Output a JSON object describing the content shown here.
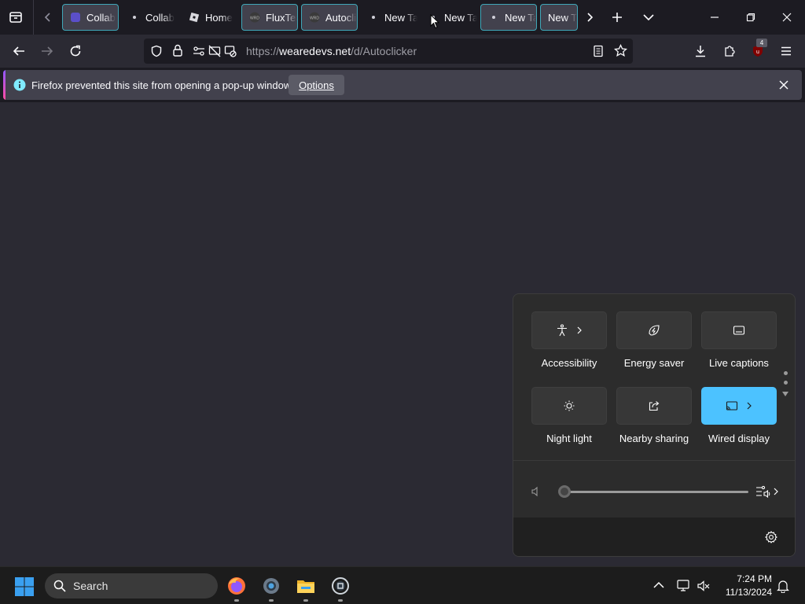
{
  "browser": {
    "tabs": [
      {
        "label": "Collab",
        "selected": true,
        "favicon": "collab-icon"
      },
      {
        "label": "Collab",
        "selected": false,
        "favicon": "dot"
      },
      {
        "label": "Home",
        "selected": false,
        "favicon": "roblox-icon"
      },
      {
        "label": "FluxTeam",
        "selected": true,
        "favicon": "wrd-icon"
      },
      {
        "label": "Autoclicker",
        "selected": true,
        "favicon": "wrd-icon"
      },
      {
        "label": "New Tab",
        "selected": false,
        "favicon": "dot"
      },
      {
        "label": "New Tab",
        "selected": false,
        "favicon": "dot"
      },
      {
        "label": "New Tab",
        "selected": true,
        "favicon": "dot"
      },
      {
        "label": "New Tab",
        "selected": true,
        "favicon": "none"
      }
    ],
    "url_prefix": "https://",
    "url_host": "wearedevs.net",
    "url_path": "/d/Autoclicker",
    "extensions_badge": "4"
  },
  "notification": {
    "message": "Firefox prevented this site from opening a pop-up window.",
    "options_label": "Options"
  },
  "quick_settings": {
    "tiles": [
      {
        "label": "Accessibility",
        "icon": "accessibility-icon",
        "chevron": true,
        "active": false
      },
      {
        "label": "Energy saver",
        "icon": "energy-saver-icon",
        "chevron": false,
        "active": false
      },
      {
        "label": "Live captions",
        "icon": "live-captions-icon",
        "chevron": false,
        "active": false
      },
      {
        "label": "Night light",
        "icon": "night-light-icon",
        "chevron": false,
        "active": false
      },
      {
        "label": "Nearby sharing",
        "icon": "nearby-sharing-icon",
        "chevron": false,
        "active": true
      },
      {
        "label": "Wired display",
        "icon": "wired-display-icon",
        "chevron": true,
        "active": true
      }
    ],
    "volume_level": 0,
    "accent_color": "#4cc2ff"
  },
  "taskbar": {
    "search_label": "Search",
    "time": "7:24 PM",
    "date": "11/13/2024"
  }
}
